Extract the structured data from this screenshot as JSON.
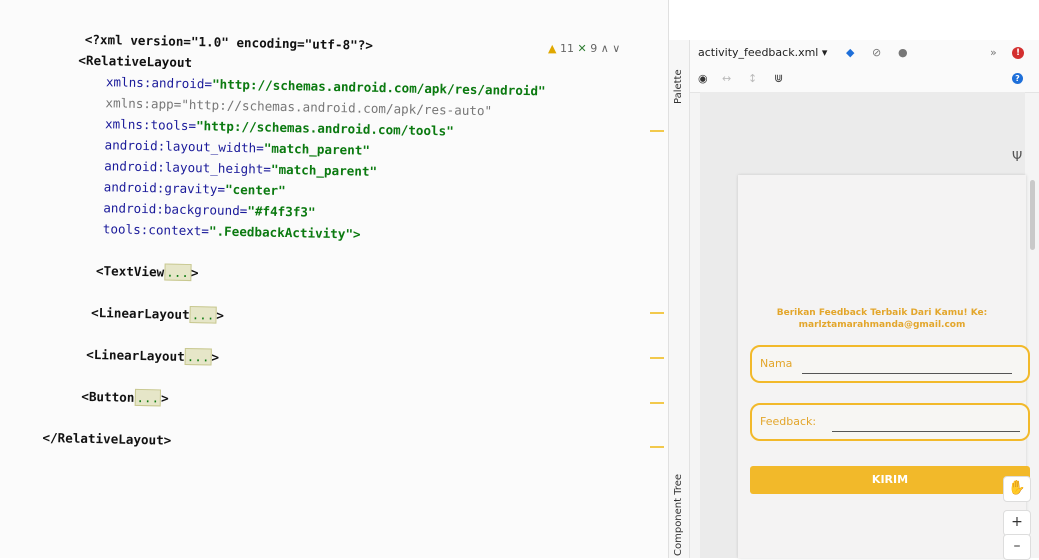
{
  "editor": {
    "lines": {
      "l1": "<?xml version=\"1.0\" encoding=\"utf-8\"?>",
      "l2": "<RelativeLayout",
      "l3_attr": "xmlns:android=",
      "l3_val": "\"http://schemas.android.com/apk/res/android\"",
      "l4_attr": "xmlns:app=",
      "l4_val": "\"http://schemas.android.com/apk/res-auto\"",
      "l5_attr": "xmlns:tools=",
      "l5_val": "\"http://schemas.android.com/tools\"",
      "l6_attr": "android:layout_width=",
      "l6_val": "\"match_parent\"",
      "l7_attr": "android:layout_height=",
      "l7_val": "\"match_parent\"",
      "l8_attr": "android:gravity=",
      "l8_val": "\"center\"",
      "l9_attr": "android:background=",
      "l9_val": "\"#f4f3f3\"",
      "l10_attr": "tools:context=",
      "l10_val": "\".FeedbackActivity\">",
      "tv": "<TextView",
      "ll1": "<LinearLayout",
      "ll2": "<LinearLayout",
      "btn": "<Button",
      "fold": "...",
      "close_tag": ">",
      "end": "</RelativeLayout>"
    },
    "warnings": {
      "warn_count": "11",
      "ok_count": "9"
    }
  },
  "side": {
    "palette_label": "Palette",
    "tree_label": "Component Tree"
  },
  "design_toolbar": {
    "file": "activity_feedback.xml ▾",
    "more": "»",
    "error": "!",
    "info": "?"
  },
  "preview": {
    "title_line1": "Berikan Feedback Terbaik Dari Kamu! Ke:",
    "title_line2": "marlztamarahmanda@gmail.com",
    "name_placeholder": "Nama",
    "feedback_label": "Feedback:",
    "button_label": "KIRIM"
  },
  "zoom": {
    "plus": "+",
    "minus": "–"
  },
  "colors": {
    "accent": "#f2b92a",
    "text_accent": "#e3a62b",
    "string": "#0b7a10",
    "background": "#f4f3f3"
  }
}
